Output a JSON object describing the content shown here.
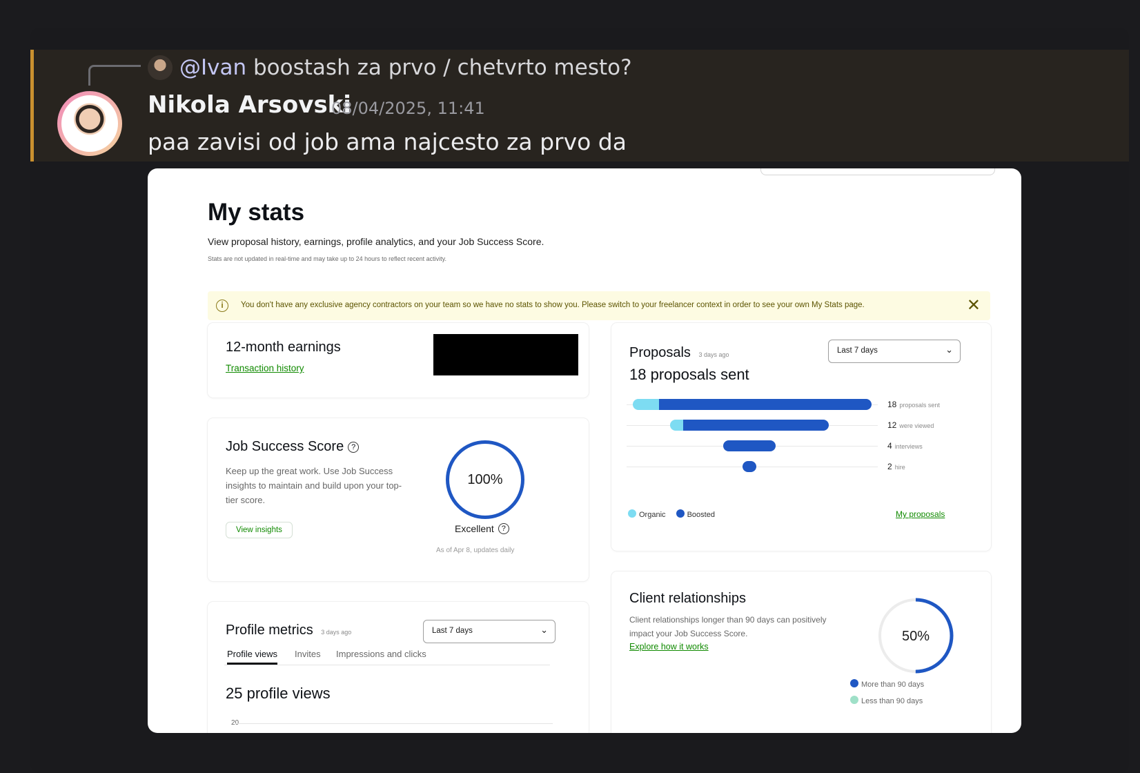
{
  "chat": {
    "reply": {
      "mention": "@Ivan",
      "text": "boostash za prvo / chetvrto mesto?"
    },
    "message": {
      "author": "Nikola Arsovski",
      "timestamp": "08/04/2025, 11:41",
      "text": "paa zavisi od job ama najcesto za prvo da"
    }
  },
  "stats_page": {
    "title": "My stats",
    "subtitle": "View proposal history, earnings, profile analytics, and your Job Success Score.",
    "note": "Stats are not updated in real-time and may take up to 24 hours to reflect recent activity.",
    "alert": "You don't have any exclusive agency contractors on your team so we have no stats to show you. Please switch to your freelancer context in order to see your own My Stats page.",
    "earnings": {
      "title": "12-month earnings",
      "link": "Transaction history"
    },
    "jss": {
      "title": "Job Success Score",
      "description": "Keep up the great work. Use Job Success insights to maintain and build upon your top-tier score.",
      "button": "View insights",
      "score": "100%",
      "score_value": 1.0,
      "rating": "Excellent",
      "updated": "As of Apr 8, updates daily"
    },
    "profile_metrics": {
      "title": "Profile metrics",
      "ago": "3 days ago",
      "period": "Last 7 days",
      "tabs": [
        "Profile views",
        "Invites",
        "Impressions and clicks"
      ],
      "headline": "25 profile views",
      "axis_tick": "20"
    },
    "proposals": {
      "title": "Proposals",
      "ago": "3 days ago",
      "period": "Last 7 days",
      "headline": "18 proposals sent",
      "funnel": [
        {
          "value": "18",
          "label": "proposals sent",
          "organic": 2,
          "boosted": 16
        },
        {
          "value": "12",
          "label": "were viewed",
          "organic": 1,
          "boosted": 11
        },
        {
          "value": "4",
          "label": "interviews",
          "organic": 0,
          "boosted": 4
        },
        {
          "value": "2",
          "label": "hire",
          "organic": 0,
          "boosted": 1
        }
      ],
      "legend": [
        "Organic",
        "Boosted"
      ],
      "link": "My proposals",
      "colors": {
        "organic": "#7ddcf2",
        "boosted": "#1f57c3"
      }
    },
    "client_relationships": {
      "title": "Client relationships",
      "description": "Client relationships longer than 90 days can positively impact your Job Success Score.",
      "link": "Explore how it works",
      "percent": "50%",
      "percent_value": 0.5,
      "legend": [
        "More than 90 days",
        "Less than 90 days"
      ],
      "colors": {
        "more": "#1f57c3",
        "less": "#9fe0c8"
      }
    }
  }
}
